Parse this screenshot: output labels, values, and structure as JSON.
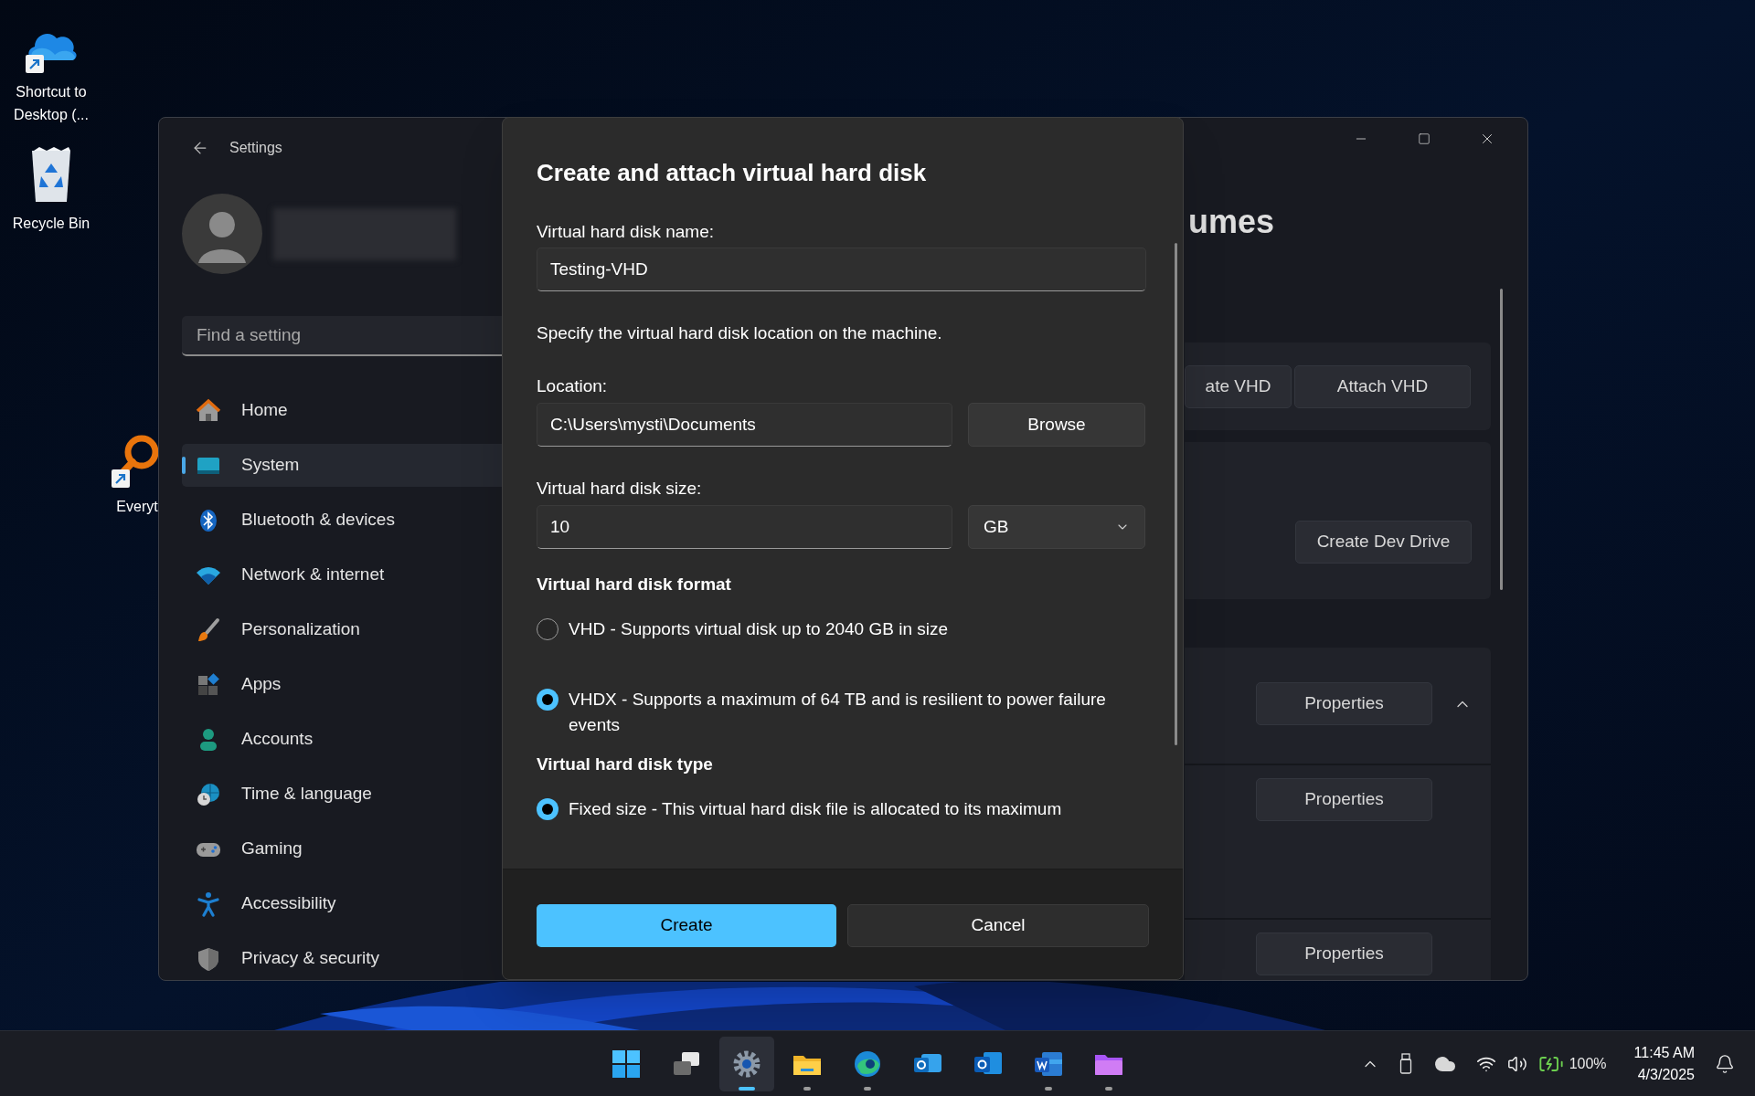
{
  "desktop_icons": [
    {
      "kind": "onedrive",
      "shortcut": true,
      "lines": [
        "Shortcut to",
        "Desktop (..."
      ]
    },
    {
      "kind": "recycle",
      "shortcut": false,
      "lines": [
        "Recycle Bin"
      ]
    },
    {
      "kind": "everything",
      "shortcut": true,
      "lines": [
        "Everyt"
      ]
    }
  ],
  "settings": {
    "title": "Settings",
    "search": {
      "placeholder": "Find a setting"
    },
    "nav": [
      {
        "kind": "home",
        "label": "Home",
        "selected": false
      },
      {
        "kind": "system",
        "label": "System",
        "selected": true
      },
      {
        "kind": "bluetooth",
        "label": "Bluetooth & devices",
        "selected": false
      },
      {
        "kind": "network",
        "label": "Network & internet",
        "selected": false
      },
      {
        "kind": "personalization",
        "label": "Personalization",
        "selected": false
      },
      {
        "kind": "apps",
        "label": "Apps",
        "selected": false
      },
      {
        "kind": "accounts",
        "label": "Accounts",
        "selected": false
      },
      {
        "kind": "time",
        "label": "Time & language",
        "selected": false
      },
      {
        "kind": "gaming",
        "label": "Gaming",
        "selected": false
      },
      {
        "kind": "accessibility",
        "label": "Accessibility",
        "selected": false
      },
      {
        "kind": "privacy",
        "label": "Privacy & security",
        "selected": false
      }
    ],
    "heading": "umes",
    "vhd_buttons": [
      "ate VHD",
      "Attach VHD"
    ],
    "dev_drive_button": "Create Dev Drive",
    "volumes": [
      {
        "button": "Properties",
        "expanded": true
      },
      {
        "button": "Properties"
      },
      {
        "button": "Properties"
      }
    ]
  },
  "dialog": {
    "title": "Create and attach virtual hard disk",
    "name_label": "Virtual hard disk name:",
    "name_value": "Testing-VHD",
    "location_hint": "Specify the virtual hard disk location on the machine.",
    "location_label": "Location:",
    "location_value": "C:\\Users\\mysti\\Documents",
    "browse": "Browse",
    "size_label": "Virtual hard disk size:",
    "size_value": "10",
    "size_unit": "GB",
    "format_heading": "Virtual hard disk format",
    "formats": [
      {
        "label": "VHD - Supports virtual disk up to 2040 GB in size",
        "selected": false
      },
      {
        "label": "VHDX - Supports a maximum of 64 TB and is resilient to power failure events",
        "selected": true
      }
    ],
    "type_heading": "Virtual hard disk type",
    "types": [
      {
        "label": "Fixed size - This virtual hard disk file is allocated to its maximum",
        "selected": true
      }
    ],
    "buttons": [
      {
        "label": "Create",
        "kind": "primary"
      },
      {
        "label": "Cancel",
        "kind": "secondary"
      }
    ]
  },
  "taskbar": {
    "apps": [
      {
        "kind": "start",
        "running": false,
        "active": false
      },
      {
        "kind": "taskview",
        "running": false,
        "active": false
      },
      {
        "kind": "settings",
        "running": true,
        "active": true
      },
      {
        "kind": "explorer",
        "running": true,
        "active": false
      },
      {
        "kind": "edge",
        "running": true,
        "active": false
      },
      {
        "kind": "outlook_new",
        "running": false,
        "active": false
      },
      {
        "kind": "outlook",
        "running": false,
        "active": false
      },
      {
        "kind": "word",
        "running": true,
        "active": false
      },
      {
        "kind": "folder",
        "running": true,
        "active": false
      }
    ],
    "battery": "100%",
    "time": "11:45 AM",
    "date": "4/3/2025"
  }
}
